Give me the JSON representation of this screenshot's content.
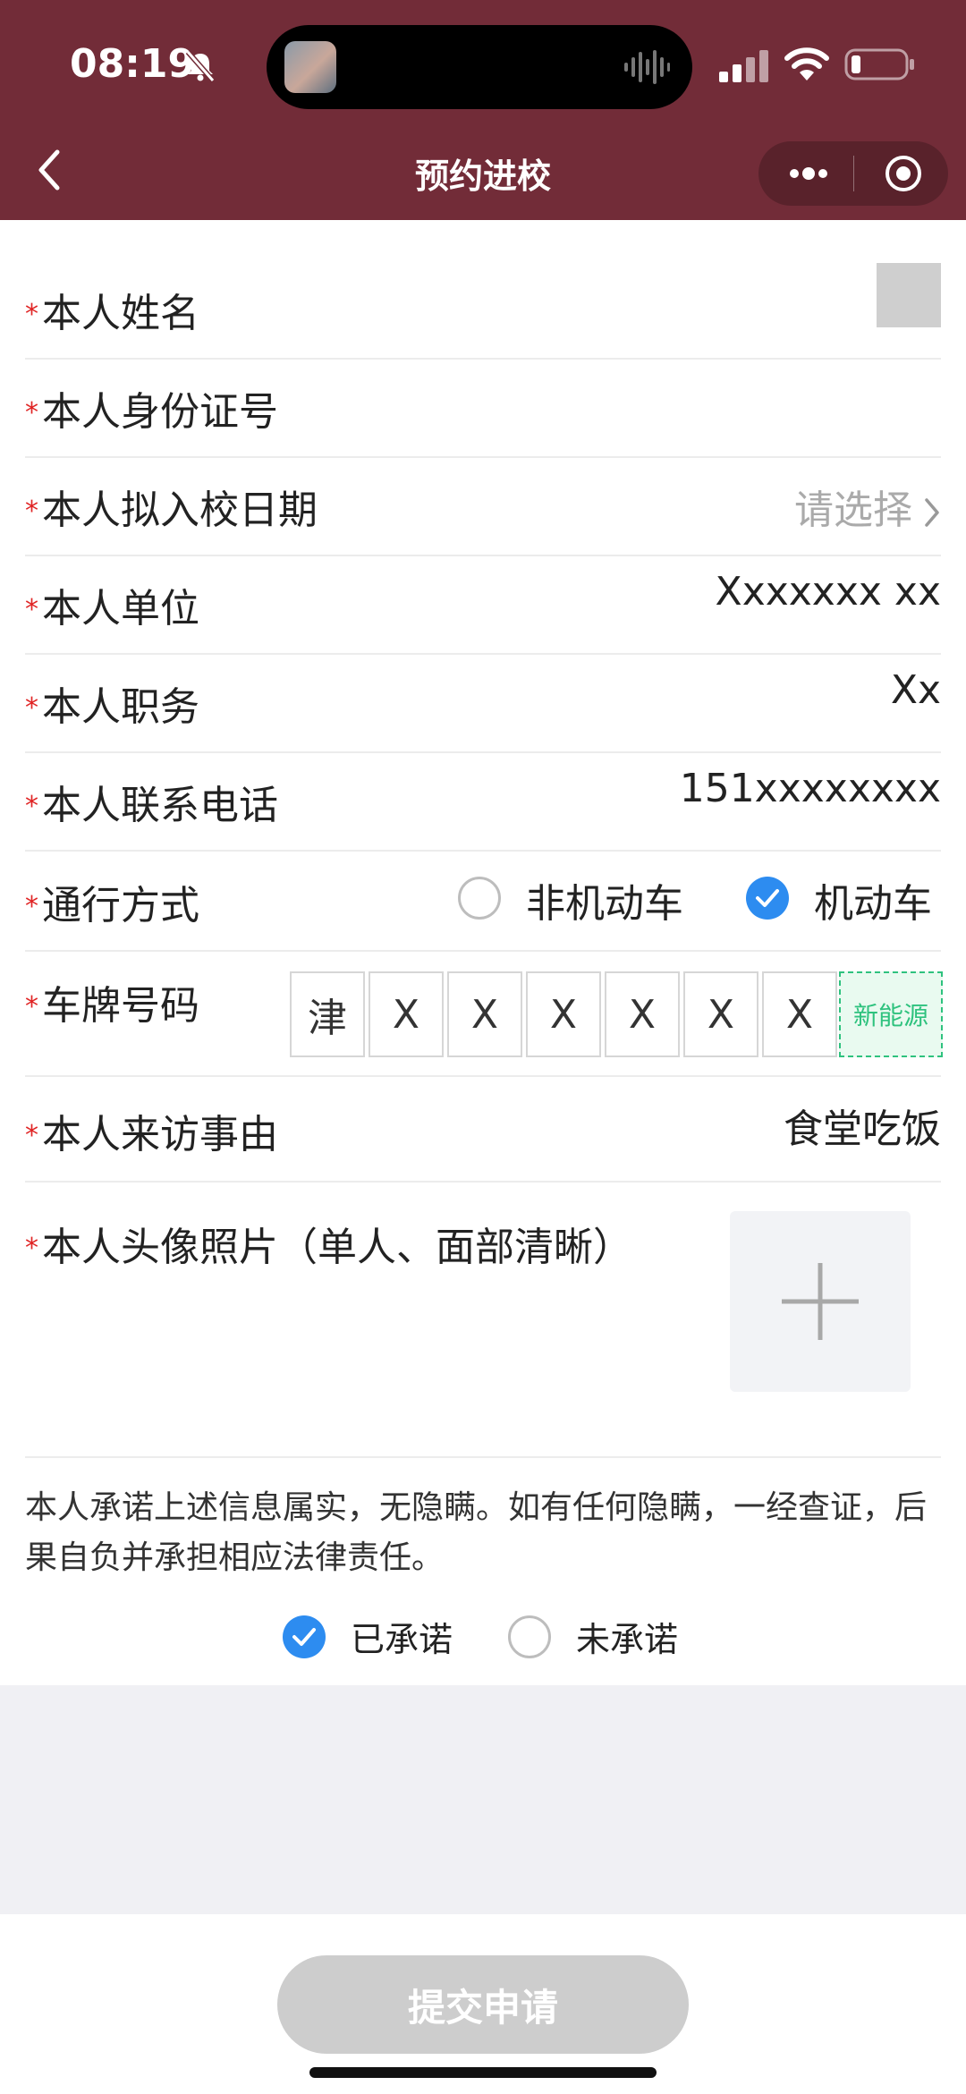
{
  "status_bar": {
    "time": "08:19"
  },
  "nav": {
    "title": "预约进校"
  },
  "form": {
    "required_mark": "*",
    "name": {
      "label": "本人姓名"
    },
    "id_number": {
      "label": "本人身份证号"
    },
    "date": {
      "label": "本人拟入校日期",
      "placeholder": "请选择"
    },
    "unit": {
      "label": "本人单位",
      "value": "Xxxxxxx xx"
    },
    "position": {
      "label": "本人职务",
      "value": "Xx"
    },
    "phone": {
      "label": "本人联系电话",
      "value": "151xxxxxxxx"
    },
    "travel_mode": {
      "label": "通行方式",
      "options": [
        "非机动车",
        "机动车"
      ],
      "selected": "机动车"
    },
    "plate": {
      "label": "车牌号码",
      "chars": [
        "津",
        "X",
        "X",
        "X",
        "X",
        "X",
        "X"
      ],
      "new_energy_label": "新能源"
    },
    "reason": {
      "label": "本人来访事由",
      "value": "食堂吃饭"
    },
    "photo": {
      "label": "本人头像照片（单人、面部清晰）"
    }
  },
  "pledge": {
    "text": "本人承诺上述信息属实，无隐瞒。如有任何隐瞒，一经查证，后果自负并承担相应法律责任。",
    "options": [
      "已承诺",
      "未承诺"
    ],
    "selected": "已承诺"
  },
  "submit": {
    "label": "提交申请"
  },
  "colors": {
    "header": "#722c38",
    "check": "#2d8cf0",
    "new_energy": "#2ec27e",
    "required": "#e02424"
  }
}
